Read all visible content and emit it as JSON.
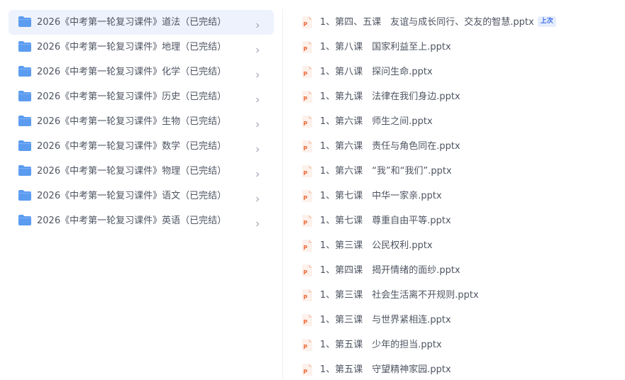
{
  "folders": [
    {
      "label": "2026《中考第一轮复习课件》道法（已完结）",
      "selected": true
    },
    {
      "label": "2026《中考第一轮复习课件》地理（已完结）",
      "selected": false
    },
    {
      "label": "2026《中考第一轮复习课件》化学（已完结）",
      "selected": false
    },
    {
      "label": "2026《中考第一轮复习课件》历史（已完结）",
      "selected": false
    },
    {
      "label": "2026《中考第一轮复习课件》生物（已完结）",
      "selected": false
    },
    {
      "label": "2026《中考第一轮复习课件》数学（已完结）",
      "selected": false
    },
    {
      "label": "2026《中考第一轮复习课件》物理（已完结）",
      "selected": false
    },
    {
      "label": "2026《中考第一轮复习课件》语文（已完结）",
      "selected": false
    },
    {
      "label": "2026《中考第一轮复习课件》英语（已完结）",
      "selected": false
    }
  ],
  "files": [
    {
      "label": "1、第四、五课　友谊与成长同行、交友的智慧.pptx",
      "badge": "上次"
    },
    {
      "label": "1、第八课　国家利益至上.pptx"
    },
    {
      "label": "1、第八课　探问生命.pptx"
    },
    {
      "label": "1、第九课　法律在我们身边.pptx"
    },
    {
      "label": "1、第六课　师生之间.pptx"
    },
    {
      "label": "1、第六课　责任与角色同在.pptx"
    },
    {
      "label": "1、第六课　“我”和“我们”.pptx"
    },
    {
      "label": "1、第七课　中华一家亲.pptx"
    },
    {
      "label": "1、第七课　尊重自由平等.pptx"
    },
    {
      "label": "1、第三课　公民权利.pptx"
    },
    {
      "label": "1、第四课　揭开情绪的面纱.pptx"
    },
    {
      "label": "1、第三课　社会生活离不开规则.pptx"
    },
    {
      "label": "1、第三课　与世界紧相连.pptx"
    },
    {
      "label": "1、第五课　少年的担当.pptx"
    },
    {
      "label": "1、第五课　守望精神家园.pptx"
    }
  ],
  "colors": {
    "folder": "#5b9cf0",
    "folder_tab": "#7fb1f4",
    "ppt_icon": "#ee6c3c",
    "selected_bg": "#eef2fc",
    "text": "#4e5461",
    "badge_text": "#3a6ee8",
    "badge_bg": "#e6edfc"
  },
  "icons": {
    "folder": "folder-icon",
    "file": "pptx-file-icon",
    "chevron": "chevron-right-icon"
  }
}
